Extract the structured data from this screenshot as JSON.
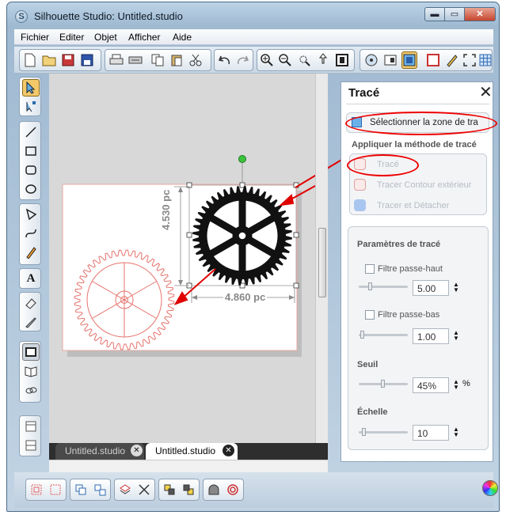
{
  "window": {
    "title": "Silhouette Studio: Untitled.studio",
    "app_icon_letter": "S",
    "min_glyph": "▬",
    "max_glyph": "▭",
    "close_glyph": "✕"
  },
  "menu": [
    "Fichier",
    "Editer",
    "Objet",
    "Afficher",
    "Aide"
  ],
  "canvas": {
    "height_dim": "4.530 pc",
    "width_dim": "4.860 pc"
  },
  "tabs": [
    {
      "label": "Untitled.studio",
      "active": false
    },
    {
      "label": "Untitled.studio",
      "active": true
    }
  ],
  "tab_close_glyph": "✕",
  "panel": {
    "title": "Tracé",
    "close_glyph": "✕",
    "select_area_label": "Sélectionner la zone de tra",
    "method_heading": "Appliquer la méthode de tracé",
    "methods": [
      "Tracé",
      "Tracer Contour extérieur",
      "Tracer et Détacher"
    ],
    "params_heading": "Paramètres de tracé",
    "highpass": {
      "label": "Filtre passe-haut",
      "value": "5.00"
    },
    "lowpass": {
      "label": "Filtre passe-bas",
      "value": "1.00"
    },
    "threshold": {
      "label": "Seuil",
      "value": "45%",
      "unit": "%"
    },
    "scale": {
      "label": "Échelle",
      "value": "10"
    }
  },
  "colors": {
    "accent_red": "#e00000",
    "workspace": "#d8d8d8",
    "tab_bar": "#2e2e2e",
    "gear_outline": "#e5736c"
  }
}
